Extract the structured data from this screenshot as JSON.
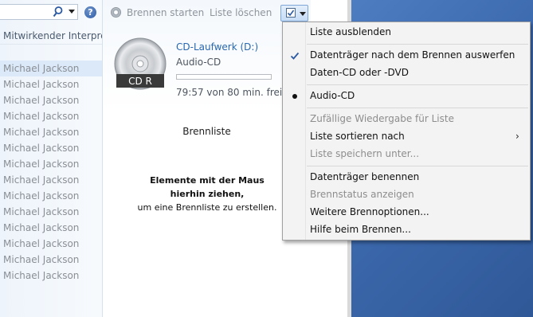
{
  "left_pane": {
    "column_header": "Mitwirkender Interpret",
    "artists": [
      "Michael Jackson",
      "Michael Jackson",
      "Michael Jackson",
      "Michael Jackson",
      "Michael Jackson",
      "Michael Jackson",
      "Michael Jackson",
      "Michael Jackson",
      "Michael Jackson",
      "Michael Jackson",
      "Michael Jackson",
      "Michael Jackson",
      "Michael Jackson",
      "Michael Jackson"
    ],
    "help_glyph": "?"
  },
  "toolbar": {
    "start_burn": "Brennen starten",
    "clear_list": "Liste löschen"
  },
  "drive": {
    "name": "CD-Laufwerk (D:)",
    "type": "Audio-CD",
    "disc_label": "CD R",
    "free_text": "79:57 von 80 min. frei",
    "used_fraction": 0.0
  },
  "burn_list": {
    "title": "Brennliste",
    "hint_bold": "Elemente mit der Maus hierhin ziehen,",
    "hint_rest": "um eine Brennliste zu erstellen."
  },
  "menu": {
    "items": [
      {
        "label": "Liste ausblenden",
        "enabled": true,
        "mark": ""
      },
      {
        "label": "Datenträger nach dem Brennen auswerfen",
        "enabled": true,
        "mark": "check"
      },
      {
        "label": "Daten-CD oder -DVD",
        "enabled": true,
        "mark": ""
      },
      {
        "label": "Audio-CD",
        "enabled": true,
        "mark": "bullet"
      },
      {
        "label": "Zufällige Wiedergabe für Liste",
        "enabled": false,
        "mark": ""
      },
      {
        "label": "Liste sortieren nach",
        "enabled": true,
        "mark": "",
        "submenu": true
      },
      {
        "label": "Liste speichern unter...",
        "enabled": false,
        "mark": ""
      },
      {
        "label": "Datenträger benennen",
        "enabled": true,
        "mark": ""
      },
      {
        "label": "Brennstatus anzeigen",
        "enabled": false,
        "mark": ""
      },
      {
        "label": "Weitere Brennoptionen...",
        "enabled": true,
        "mark": ""
      },
      {
        "label": "Hilfe beim Brennen...",
        "enabled": true,
        "mark": ""
      }
    ],
    "submenu_arrow": "›"
  },
  "colors": {
    "accent_link": "#2867b0",
    "desktop_blue": "#3c69ad",
    "selection": "#dce9f8"
  },
  "icons": {
    "search": "magnifier-icon",
    "help": "help-icon",
    "burn": "burn-disc-icon",
    "options": "list-options-icon",
    "disc": "cd-disc-icon"
  }
}
